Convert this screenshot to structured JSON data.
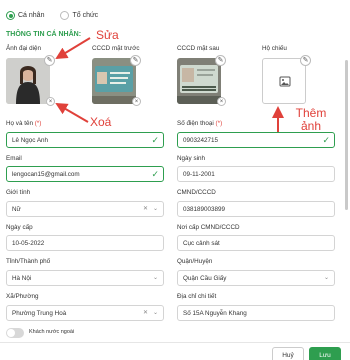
{
  "customer_type": {
    "option1": "Cá nhân",
    "option2": "Tổ chức",
    "selected": "Cá nhân"
  },
  "section_title": "THÔNG TIN CÁ NHÂN:",
  "documents": {
    "avatar_label": "Ảnh đại diện",
    "cccd_front_label": "CCCD mặt trước",
    "cccd_back_label": "CCCD mặt sau",
    "passport_label": "Hộ chiếu"
  },
  "annotations": {
    "edit": "Sửa",
    "delete": "Xoá",
    "add": "Thêm ảnh"
  },
  "form": {
    "fullname_label": "Họ và tên",
    "fullname_required": "(*)",
    "fullname_value": "Lê Ngọc Anh",
    "phone_label": "Số điện thoại",
    "phone_required": "(*)",
    "phone_value": "0903242715",
    "email_label": "Email",
    "email_value": "lengocan15@gmail.com",
    "birthday_label": "Ngày sinh",
    "birthday_value": "09-11-2001",
    "gender_label": "Giới tính",
    "gender_value": "Nữ",
    "id_number_label": "CMND/CCCD",
    "id_number_value": "038189003899",
    "issue_date_label": "Ngày cấp",
    "issue_date_value": "10-05-2022",
    "issue_place_label": "Nơi cấp CMND/CCCD",
    "issue_place_value": "Cục cảnh sát",
    "province_label": "Tỉnh/Thành phố",
    "province_value": "Hà Nội",
    "district_label": "Quận/Huyện",
    "district_value": "Quận Cầu Giấy",
    "ward_label": "Xã/Phường",
    "ward_value": "Phường Trung Hoà",
    "address_label": "Địa chỉ chi tiết",
    "address_value": "Số 15A Nguyễn Khang",
    "foreigner_label": "Khách nước ngoài"
  },
  "buttons": {
    "cancel": "Huỷ",
    "save": "Lưu"
  },
  "colors": {
    "accent": "#2e9e4f",
    "required": "#e0413a",
    "annotation": "#e0413a"
  }
}
